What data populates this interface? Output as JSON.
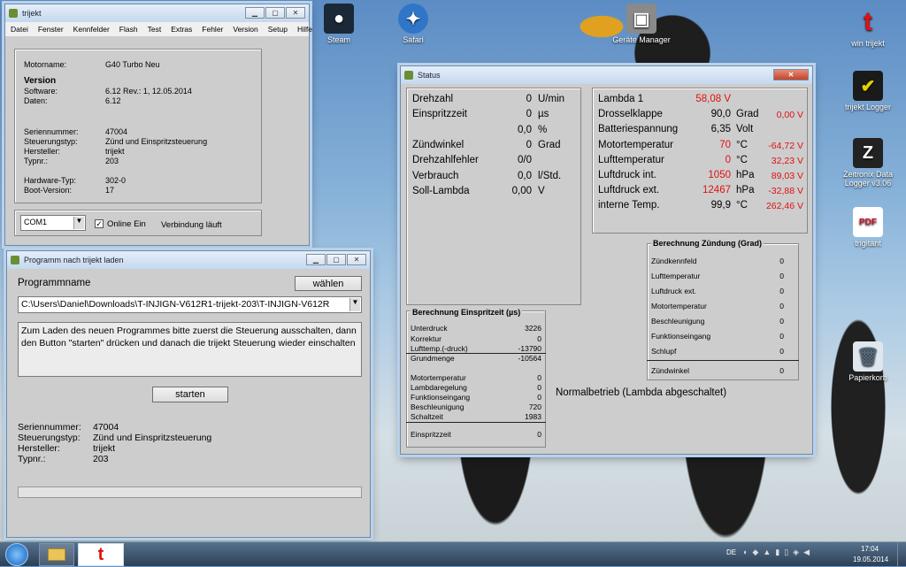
{
  "desktop": {
    "icons": [
      {
        "label": "Steam",
        "color": "#1b2838"
      },
      {
        "label": "Safari",
        "color": "#2f76c9"
      },
      {
        "label": "Geräte Manager",
        "color": "#888"
      },
      {
        "label": "win trijekt",
        "color": "#ffffff"
      },
      {
        "label": "trijekt Logger",
        "color": "#1a1a1a"
      },
      {
        "label": "Zeitronix Data Logger v3.06",
        "color": "#222222"
      },
      {
        "label": "trigitant",
        "color": "#c8102e"
      },
      {
        "label": "Papierkorb",
        "color": "#dfe6ee"
      }
    ]
  },
  "main": {
    "title": "trijekt",
    "menu": [
      "Datei",
      "Fenster",
      "Kennfelder",
      "Flash",
      "Test",
      "Extras",
      "Fehler",
      "Version",
      "Setup",
      "Hilfe"
    ],
    "motorname_label": "Motorname:",
    "motorname": "G40 Turbo Neu",
    "version_heading": "Version",
    "software_label": "Software:",
    "software": "6.12 Rev.: 1, 12.05.2014",
    "daten_label": "Daten:",
    "daten": "6.12",
    "serien_label": "Seriennummer:",
    "serien": "47004",
    "steuer_label": "Steuerungstyp:",
    "steuer": "Zünd und Einspritzsteuerung",
    "herst_label": "Hersteller:",
    "herst": "trijekt",
    "typ_label": "Typnr.:",
    "typ": "203",
    "hw_label": "Hardware-Typ:",
    "hw": "302-0",
    "boot_label": "Boot-Version:",
    "boot": "17",
    "com": "COM1",
    "online_label": "Online Ein",
    "online_checked": true,
    "verbindung": "Verbindung läuft"
  },
  "loader": {
    "title": "Programm nach trijekt laden",
    "programmname_label": "Programmname",
    "waehlen": "wählen",
    "path": "C:\\Users\\Daniel\\Downloads\\T-INJIGN-V612R1-trijekt-203\\T-INJIGN-V612R",
    "instruction": "Zum Laden des neuen Programmes bitte zuerst die Steuerung ausschalten, dann den Button \"starten\"  drücken und danach die trijekt Steuerung wieder einschalten",
    "starten": "starten",
    "serien_label": "Seriennummer:",
    "serien": "47004",
    "steuer_label": "Steuerungstyp:",
    "steuer": "Zünd und Einspritzsteuerung",
    "herst_label": "Hersteller:",
    "herst": "trijekt",
    "typ_label": "Typnr.:",
    "typ": "203"
  },
  "status": {
    "title": "Status",
    "left": [
      {
        "label": "Drehzahl",
        "value": "0",
        "unit": "U/min"
      },
      {
        "label": "Einspritzzeit",
        "value": "0",
        "unit": "µs"
      },
      {
        "label": "",
        "value": "0,0",
        "unit": "%"
      },
      {
        "label": "Zündwinkel",
        "value": "0",
        "unit": "Grad"
      },
      {
        "label": "Drehzahlfehler",
        "value": "0/0",
        "unit": ""
      },
      {
        "label": "Verbrauch",
        "value": "0,0",
        "unit": "l/Std."
      },
      {
        "label": "Soll-Lambda",
        "value": "0,00",
        "unit": "V"
      }
    ],
    "right": [
      {
        "label": "Lambda 1",
        "value": "58,08 V",
        "unit": "",
        "extra": "",
        "red": true
      },
      {
        "label": "Drosselklappe",
        "value": "90,0",
        "unit": "Grad",
        "extra": "0,00 V",
        "red": false
      },
      {
        "label": "Batteriespannung",
        "value": "6,35",
        "unit": "Volt",
        "extra": "",
        "red": false
      },
      {
        "label": "Motortemperatur",
        "value": "70",
        "unit": "°C",
        "extra": "-64,72 V",
        "red": true
      },
      {
        "label": "Lufttemperatur",
        "value": "0",
        "unit": "°C",
        "extra": "32,23 V",
        "red": true
      },
      {
        "label": "Luftdruck int.",
        "value": "1050",
        "unit": "hPa",
        "extra": "89,03 V",
        "red": true
      },
      {
        "label": "Luftdruck ext.",
        "value": "12467",
        "unit": "hPa",
        "extra": "-32,88 V",
        "red": true
      },
      {
        "label": "interne Temp.",
        "value": "99,9",
        "unit": "°C",
        "extra": "262,46 V",
        "red": false
      }
    ],
    "einspritz_title": "Berechnung Einspritzeit (µs)",
    "einspritz": [
      {
        "label": "Unterdruck",
        "value": "3226"
      },
      {
        "label": "Korrektur",
        "value": "0"
      },
      {
        "label": "Lufttemp.(-druck)",
        "value": "-13790"
      },
      {
        "label": "Grundmenge",
        "value": "-10564"
      },
      {
        "label": "Motortemperatur",
        "value": "0"
      },
      {
        "label": "Lambdaregelung",
        "value": "0"
      },
      {
        "label": "Funktionseingang",
        "value": "0"
      },
      {
        "label": "Beschleunigung",
        "value": "720"
      },
      {
        "label": "Schaltzeit",
        "value": "1983"
      },
      {
        "label": "Einspritzzeit",
        "value": "0"
      }
    ],
    "zuend_title": "Berechnung Zündung (Grad)",
    "zuend": [
      {
        "label": "Zündkennfeld",
        "value": "0"
      },
      {
        "label": "Lufttemperatur",
        "value": "0"
      },
      {
        "label": "Luftdruck ext.",
        "value": "0"
      },
      {
        "label": "Motortemperatur",
        "value": "0"
      },
      {
        "label": "Beschleunigung",
        "value": "0"
      },
      {
        "label": "Funktionseingang",
        "value": "0"
      },
      {
        "label": "Schlupf",
        "value": "0"
      },
      {
        "label": "Zündwinkel",
        "value": "0"
      }
    ],
    "normal": "Normalbetrieb  (Lambda abgeschaltet)"
  },
  "taskbar": {
    "lang": "DE",
    "time": "17:04",
    "date": "19.05.2014"
  }
}
